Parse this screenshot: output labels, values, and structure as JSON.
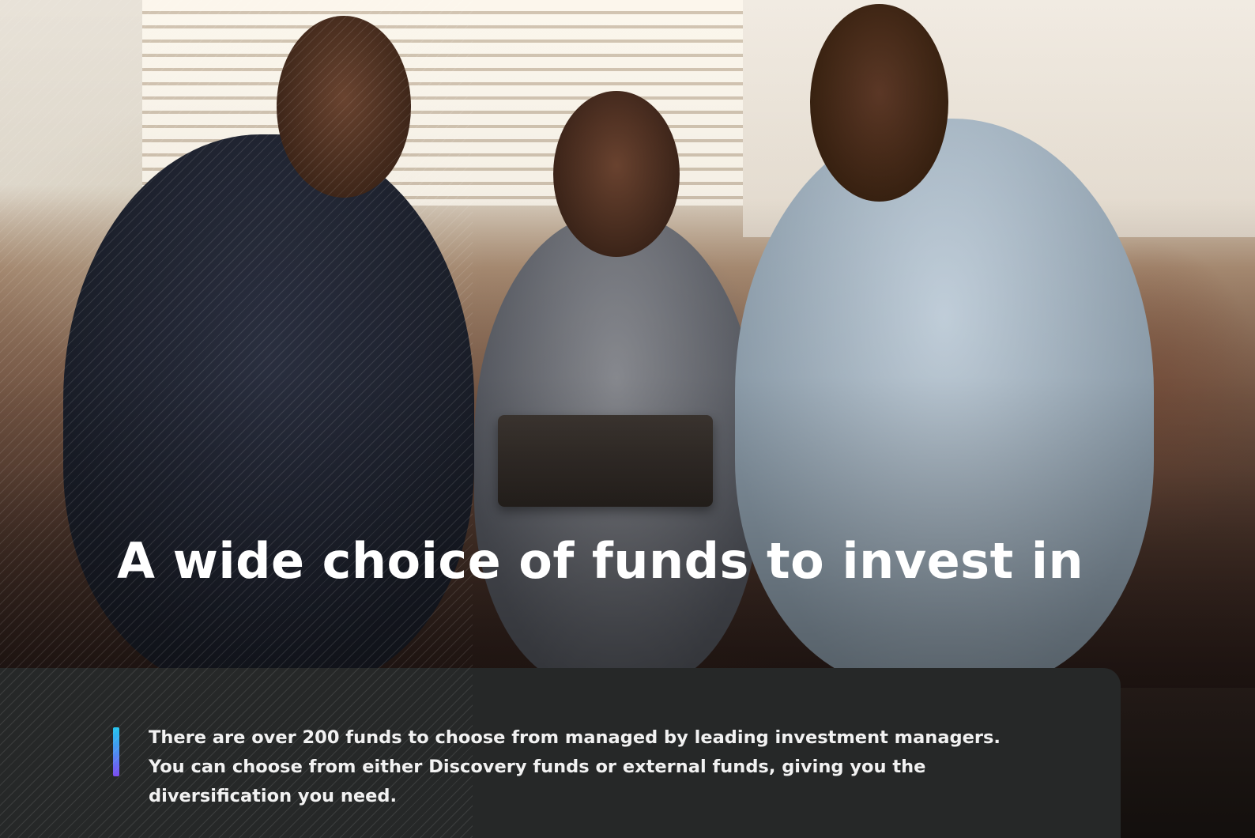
{
  "hero": {
    "heading": "A wide choice of funds to invest in",
    "photo_icon": "family-photo-icon"
  },
  "info": {
    "body": "There are over 200 funds to choose from managed by leading investment managers. You can choose from either Discovery funds or external funds, giving you the diversification you need.",
    "accent_colors": [
      "#22c4ee",
      "#4c8ff2",
      "#7b4cf0"
    ],
    "panel_color": "#262828"
  }
}
